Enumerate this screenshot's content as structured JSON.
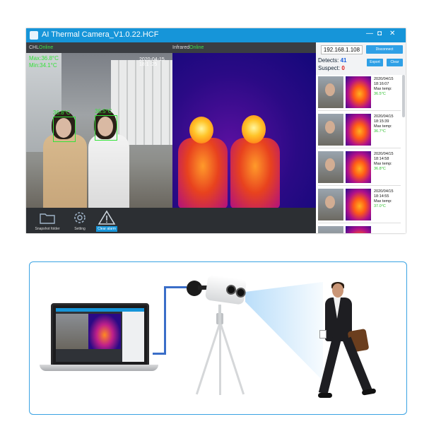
{
  "app": {
    "title": "AI Thermal Camera_V1.0.22.HCF",
    "window_controls": [
      "—",
      "◘",
      "✕"
    ]
  },
  "feeds": {
    "cam_label": "CHL",
    "cam_status": "Online",
    "ir_label": "Infrared",
    "ir_status": "Online",
    "timestamp": "2020-04-15  18:1 :25",
    "max_temp": "Max:36.8°C",
    "min_temp": "Min:34.1°C",
    "face_temps": [
      "36.8°C",
      "36.5°C"
    ]
  },
  "toolbar": {
    "items": [
      {
        "label": "Snapshot folder",
        "icon": "folder-icon"
      },
      {
        "label": "Setting",
        "icon": "gear-icon"
      },
      {
        "label": "Clear alarm",
        "icon": "warning-icon"
      }
    ]
  },
  "panel": {
    "ip": "192.168.1.108",
    "disconnect_label": "Disconnect",
    "detects_label": "Detects:",
    "detects_value": "41",
    "suspect_label": "Suspect:",
    "suspect_value": "0",
    "export_label": "Export",
    "clear_label": "Clear",
    "max_temp_label": "Max temp:",
    "records": [
      {
        "date": "2020/04/15",
        "time": "18:16:07",
        "temp": "36.5°C"
      },
      {
        "date": "2020/04/15",
        "time": "18:15:39",
        "temp": "36.7°C"
      },
      {
        "date": "2020/04/15",
        "time": "18:14:58",
        "temp": "36.8°C"
      },
      {
        "date": "2020/04/15",
        "time": "18:14:55",
        "temp": "37.0°C"
      }
    ]
  },
  "colors": {
    "accent": "#1695d9",
    "online": "#3fe04a",
    "normal_temp": "#30c030",
    "suspect": "#e01818"
  }
}
